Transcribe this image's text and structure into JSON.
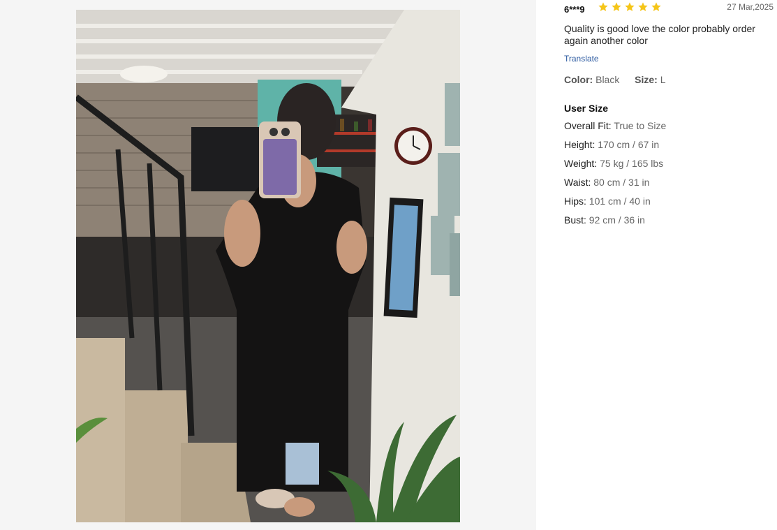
{
  "review": {
    "username": "6***9",
    "rating": 5,
    "date": "27 Mar,2025",
    "text": "Quality is good love the color probably order again another color",
    "translate_label": "Translate",
    "color_label": "Color:",
    "color_value": "Black",
    "size_label": "Size:",
    "size_value": "L"
  },
  "user_size": {
    "title": "User Size",
    "rows": [
      {
        "label": "Overall Fit:",
        "value": "True to Size"
      },
      {
        "label": "Height:",
        "value": "170 cm / 67 in"
      },
      {
        "label": "Weight:",
        "value": "75 kg / 165 lbs"
      },
      {
        "label": "Waist:",
        "value": "80 cm / 31 in"
      },
      {
        "label": "Hips:",
        "value": "101 cm / 40 in"
      },
      {
        "label": "Bust:",
        "value": "92 cm / 36 in"
      }
    ]
  },
  "colors": {
    "star": "#f5c518",
    "link": "#2c5aa0",
    "gallery_bg": "#f5f5f5"
  }
}
